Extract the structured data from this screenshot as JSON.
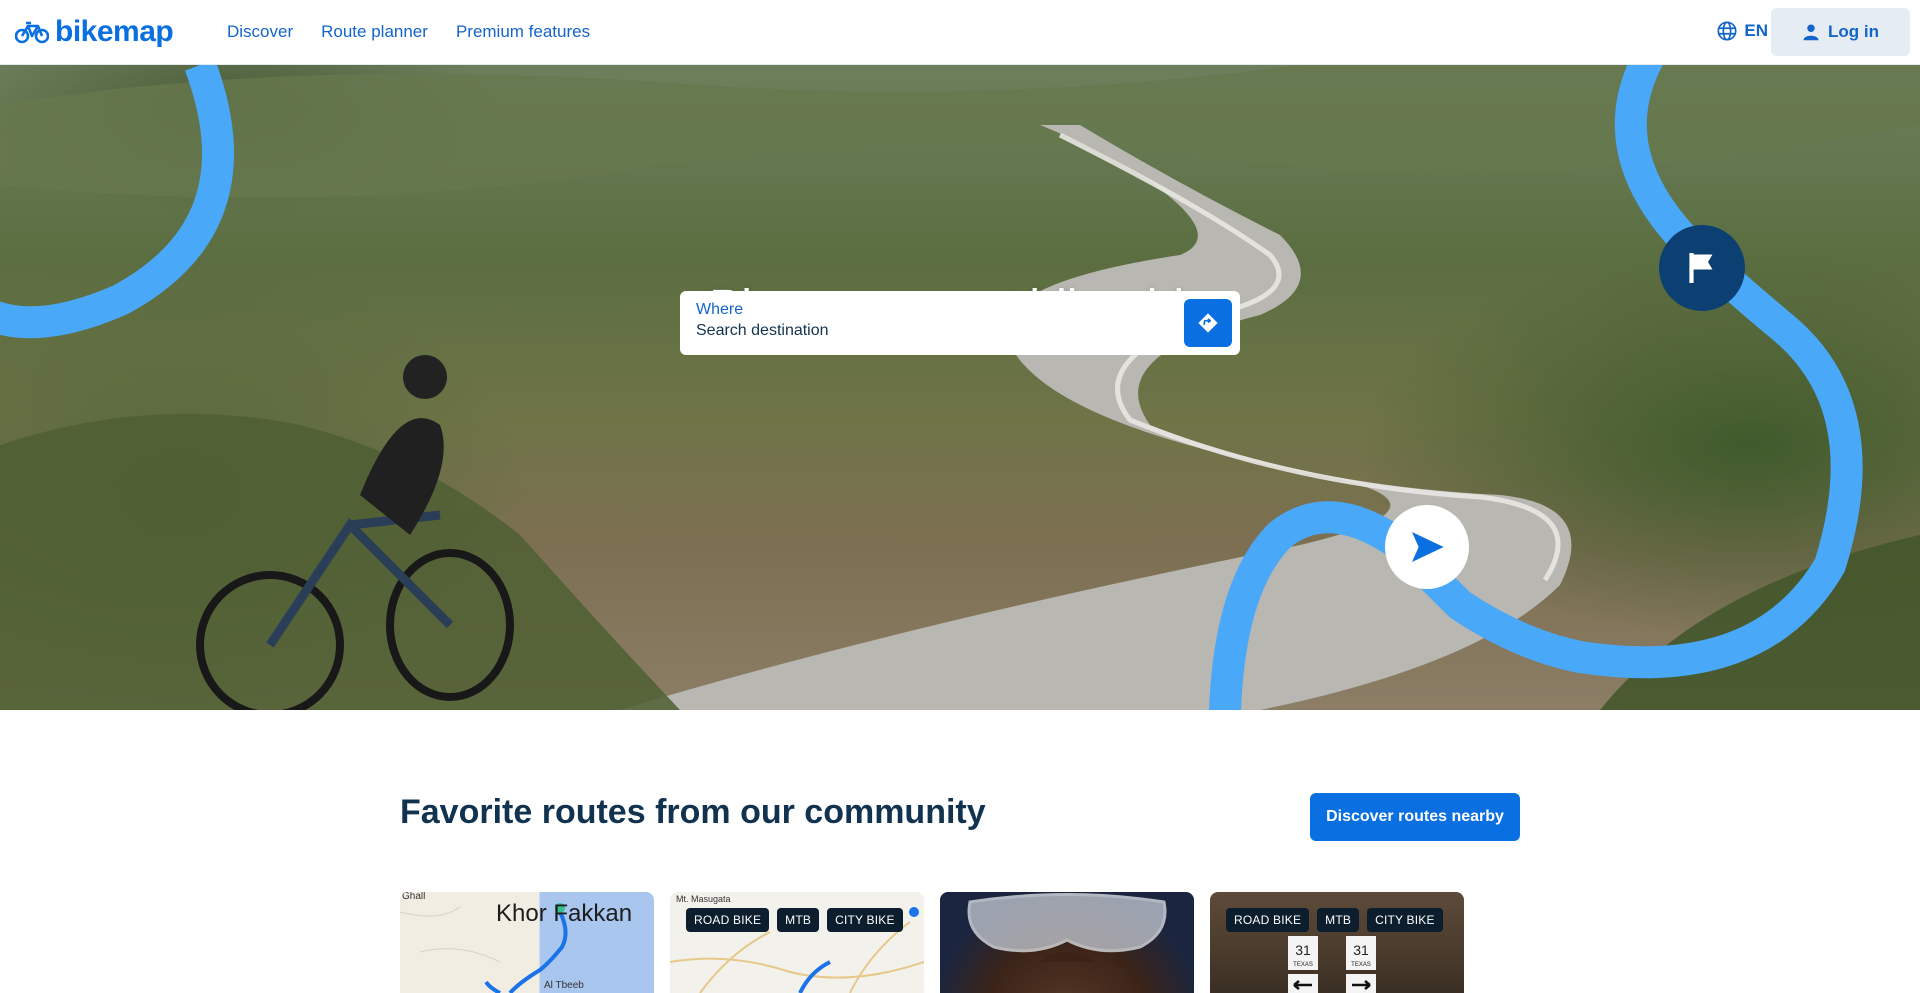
{
  "header": {
    "logo_text": "bikemap",
    "nav": [
      "Discover",
      "Route planner",
      "Premium features"
    ],
    "language": "EN",
    "login_label": "Log in"
  },
  "hero": {
    "title": "Plan your next bike ride",
    "search": {
      "label": "Where",
      "placeholder": "Search destination"
    }
  },
  "community": {
    "title": "Favorite routes from our community",
    "discover_button": "Discover routes nearby",
    "cards": [
      {
        "type": "map",
        "map_labels": [
          "Khor Fakkan",
          "Ghall",
          "Al Tbeeb"
        ]
      },
      {
        "type": "map",
        "map_labels": [
          "Mt. Masugata"
        ],
        "tags": [
          "ROAD BIKE",
          "MTB",
          "CITY BIKE"
        ]
      },
      {
        "type": "photo"
      },
      {
        "type": "photo",
        "tags": [
          "ROAD BIKE",
          "MTB",
          "CITY BIKE"
        ],
        "sign_numbers": [
          "31",
          "31"
        ],
        "sign_text": [
          "TEXAS",
          "TEXAS"
        ]
      }
    ]
  },
  "colors": {
    "brand": "#0a6fe0",
    "nav_text": "#1365c9",
    "route_line": "#4aa8f8",
    "flag_marker": "#0c3f72",
    "heading": "#11334f"
  },
  "icons": [
    "bike-logo-icon",
    "globe-icon",
    "user-icon",
    "directions-icon",
    "flag-icon",
    "play-icon"
  ]
}
